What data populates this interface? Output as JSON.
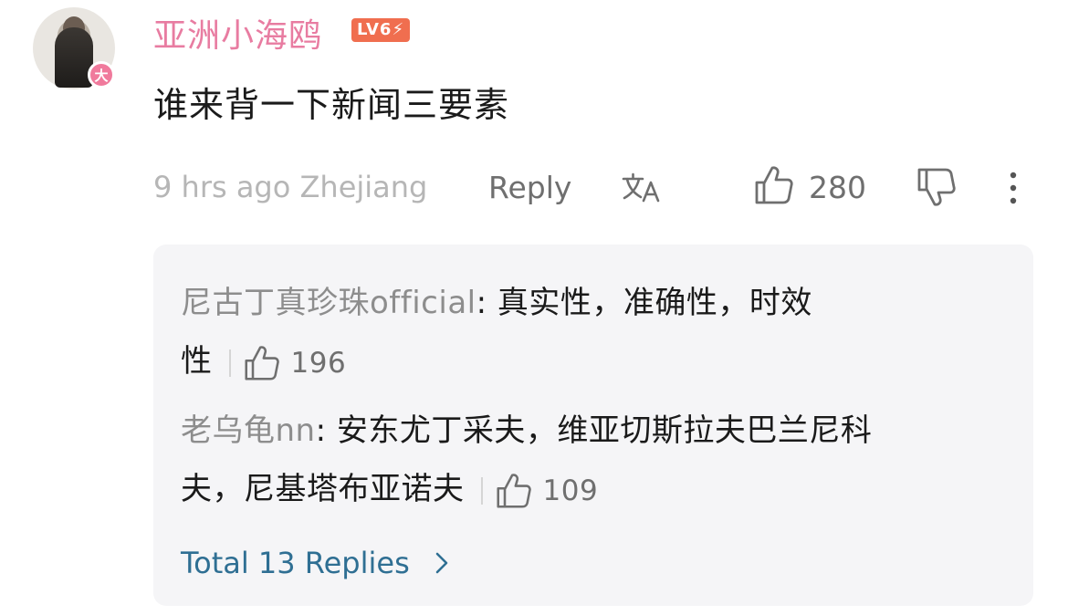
{
  "comment": {
    "username": "亚洲小海鸥",
    "level_badge": "LV6",
    "avatar_badge": "大",
    "text": "谁来背一下新闻三要素",
    "time": "9 hrs ago",
    "location": "Zhejiang",
    "reply_label": "Reply",
    "like_count": "280",
    "icons": [
      "translate-icon",
      "thumbs-up-icon",
      "thumbs-down-icon",
      "more-icon"
    ]
  },
  "replies": [
    {
      "author": "尼古丁真珍珠official",
      "text_line1": ": 真实性，准确性，时效",
      "text_line2": "性",
      "likes": "196"
    },
    {
      "author": "老乌龟nn",
      "text_line1": ": 安东尤丁采夫，维亚切斯拉夫巴兰尼科",
      "text_line2": "夫，尼基塔布亚诺夫",
      "likes": "109"
    }
  ],
  "total_replies_label": "Total 13 Replies",
  "colors": {
    "username": "#e87ca1",
    "level_badge": "#f06e4f",
    "link": "#2f6f93",
    "reply_box": "#f5f5f7"
  }
}
